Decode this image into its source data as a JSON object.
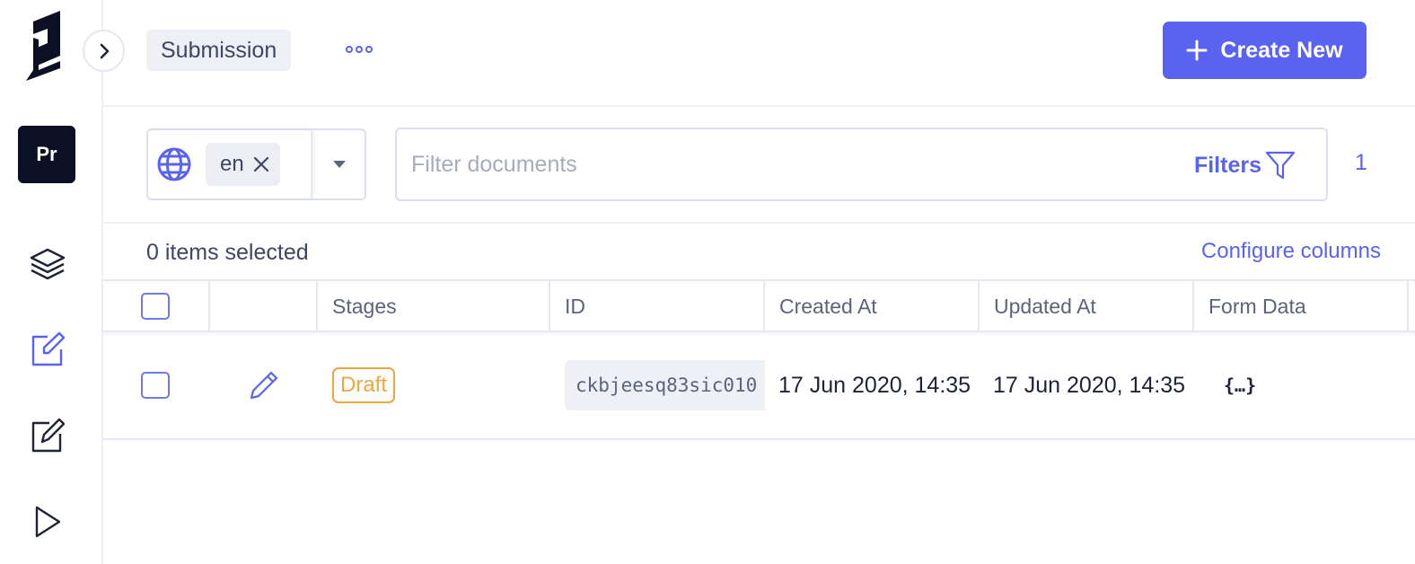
{
  "sidebar": {
    "project_initials": "Pr",
    "nav_icons": [
      "layers-icon",
      "edit-icon",
      "edit-square-icon",
      "play-icon"
    ]
  },
  "header": {
    "model_name": "Submission",
    "more_icon": "more-icon",
    "create_button": {
      "label": "Create New",
      "icon": "plus-icon"
    }
  },
  "filters": {
    "locale": {
      "value": "en",
      "icon": "globe-icon"
    },
    "search": {
      "placeholder": "Filter documents",
      "value": ""
    },
    "filters_label": "Filters",
    "filter_count": "1"
  },
  "selection": {
    "selected_text": "0 items selected",
    "configure_label": "Configure columns"
  },
  "table": {
    "columns": [
      "",
      "",
      "Stages",
      "ID",
      "Created At",
      "Updated At",
      "Form Data"
    ],
    "rows": [
      {
        "stage": "Draft",
        "id": "ckbjeesq83sic010",
        "created_at": "17 Jun 2020, 14:35",
        "updated_at": "17 Jun 2020, 14:35",
        "form_data": "{…}"
      }
    ]
  },
  "colors": {
    "accent": "#5a63ef",
    "draft": "#f0a640",
    "sidebar_badge": "#0b1024"
  }
}
